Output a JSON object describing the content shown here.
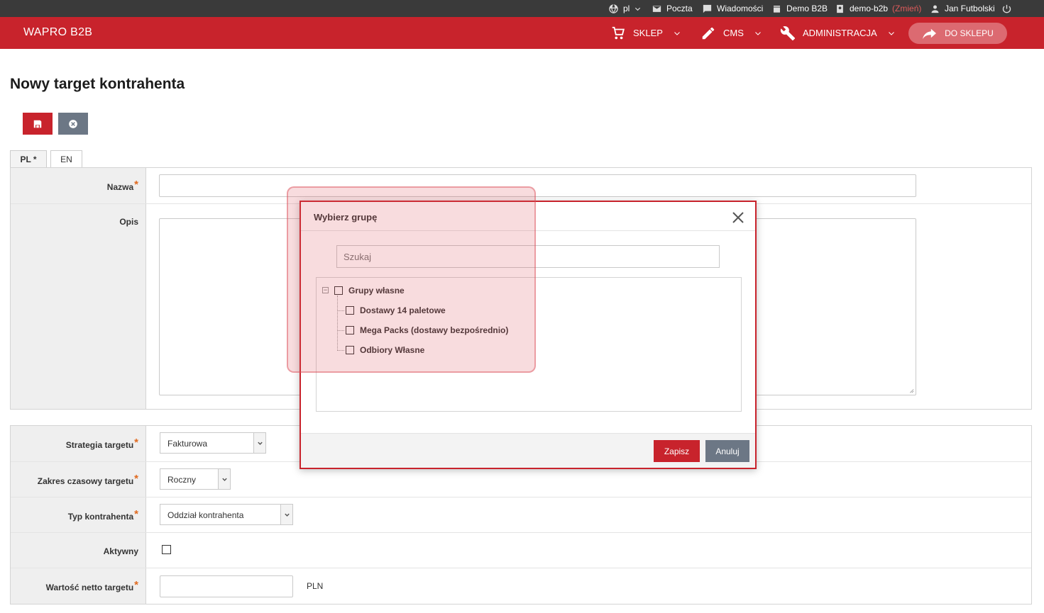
{
  "topbar": {
    "lang": "pl",
    "mail": "Poczta",
    "messages": "Wiadomości",
    "company": "Demo B2B",
    "account": "demo-b2b",
    "change": "(Zmień)",
    "user": "Jan Futbolski"
  },
  "header": {
    "brand": "WAPRO B2B",
    "nav": [
      "SKLEP",
      "CMS",
      "ADMINISTRACJA"
    ],
    "shop_button": "DO SKLEPU"
  },
  "page": {
    "title": "Nowy target kontrahenta",
    "tabs": [
      "PL *",
      "EN"
    ]
  },
  "form1": {
    "name_label": "Nazwa",
    "desc_label": "Opis",
    "required_mark": "*"
  },
  "form2": {
    "strategy_label": "Strategia targetu",
    "strategy_value": "Fakturowa",
    "range_label": "Zakres czasowy targetu",
    "range_value": "Roczny",
    "type_label": "Typ kontrahenta",
    "type_value": "Oddział kontrahenta",
    "active_label": "Aktywny",
    "value_label": "Wartość netto targetu",
    "currency": "PLN"
  },
  "modal": {
    "title": "Wybierz grupę",
    "search_placeholder": "Szukaj",
    "tree_root": "Grupy własne",
    "tree_children": [
      "Dostawy 14 paletowe",
      "Mega Packs (dostawy bezpośrednio)",
      "Odbiory Własne"
    ],
    "save": "Zapisz",
    "cancel": "Anuluj"
  },
  "colors": {
    "brand_red": "#c8232c",
    "dark_bar": "#3a3a3a",
    "gray_button": "#6c7785"
  }
}
